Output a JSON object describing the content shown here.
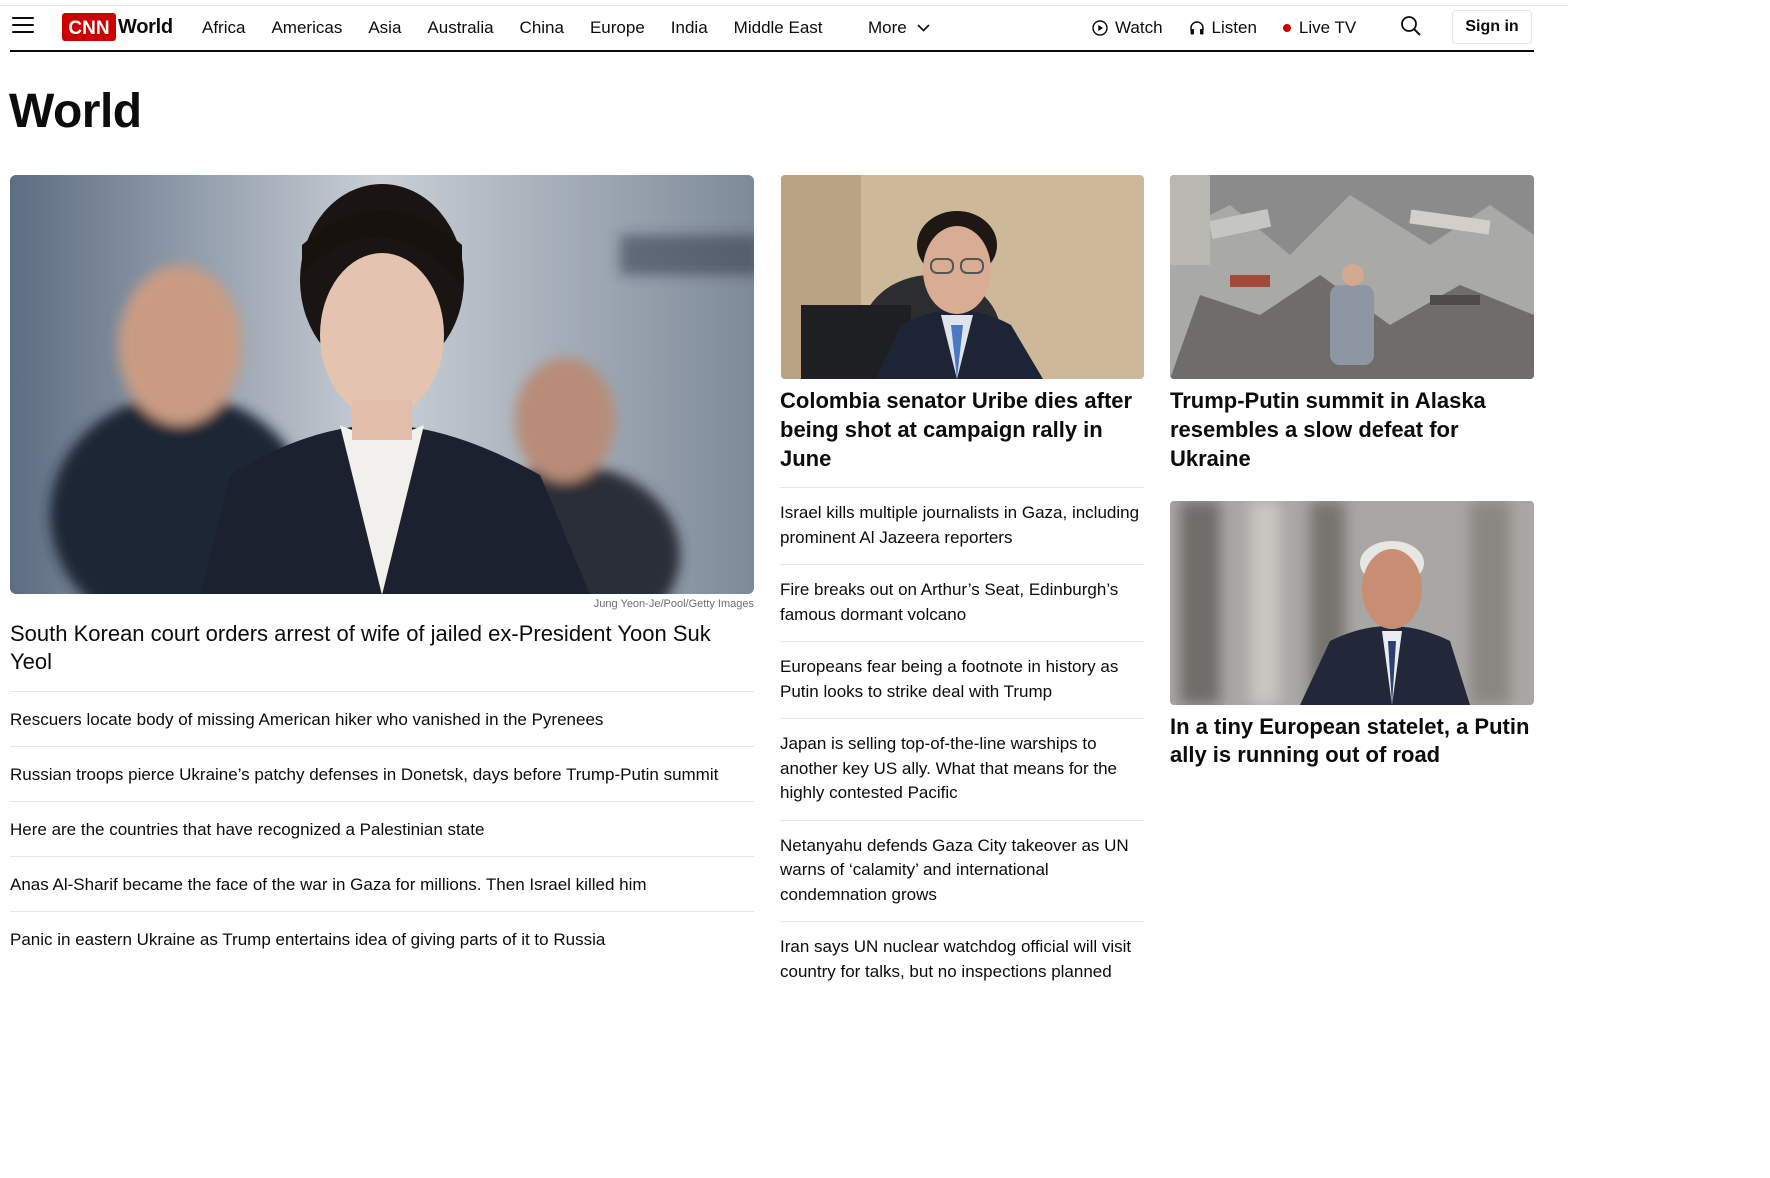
{
  "header": {
    "logo_text": "CNN",
    "section": "World",
    "nav": [
      "Africa",
      "Americas",
      "Asia",
      "Australia",
      "China",
      "Europe",
      "India",
      "Middle East"
    ],
    "more_label": "More",
    "watch_label": "Watch",
    "listen_label": "Listen",
    "live_tv_label": "Live TV",
    "sign_in_label": "Sign in",
    "brand_color": "#cc0000"
  },
  "page_title": "World",
  "lead": {
    "image_credit": "Jung Yeon-Je/Pool/Getty Images",
    "headline": "South Korean court orders arrest of wife of jailed ex-President Yoon Suk Yeol",
    "more_stories": [
      "Rescuers locate body of missing American hiker who vanished in the Pyrenees",
      "Russian troops pierce Ukraine’s patchy defenses in Donetsk, days before Trump-Putin summit",
      "Here are the countries that have recognized a Palestinian state",
      "Anas Al-Sharif became the face of the war in Gaza for millions. Then Israel killed him",
      "Panic in eastern Ukraine as Trump entertains idea of giving parts of it to Russia"
    ]
  },
  "middle": {
    "headline": "Colombia senator Uribe dies after being shot at campaign rally in June",
    "stories": [
      "Israel kills multiple journalists in Gaza, including prominent Al Jazeera reporters",
      "Fire breaks out on Arthur’s Seat, Edinburgh’s famous dormant volcano",
      "Europeans fear being a footnote in history as Putin looks to strike deal with Trump",
      "Japan is selling top-of-the-line warships to another key US ally. What that means for the highly contested Pacific",
      "Netanyahu defends Gaza City takeover as UN warns of ‘calamity’ and international condemnation grows",
      "Iran says UN nuclear watchdog official will visit country for talks, but no inspections planned"
    ]
  },
  "right": {
    "card1_headline": "Trump-Putin summit in Alaska resembles a slow defeat for Ukraine",
    "card2_headline": "In a tiny European statelet, a Putin ally is running out of road"
  }
}
